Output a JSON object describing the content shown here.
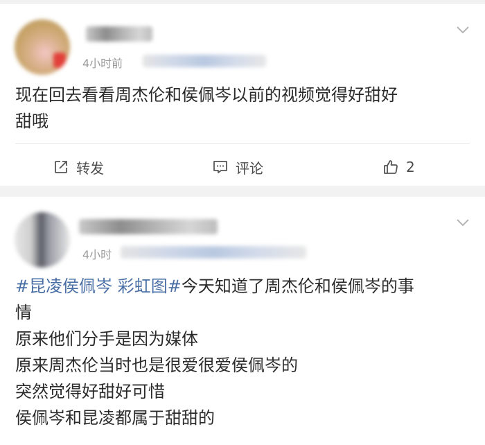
{
  "posts": [
    {
      "time": "4小时前",
      "content_lines": [
        "现在回去看看周杰伦和侯佩岑以前的视频觉得好甜好",
        "甜哦"
      ],
      "actions": {
        "repost_label": "转发",
        "comment_label": "评论",
        "like_count": "2"
      }
    },
    {
      "time": "4小时",
      "hashtag_1": "#昆凌侯佩岑",
      "hashtag_2": "彩虹图#",
      "first_line_rest": "今天知道了周杰伦和侯佩岑的事",
      "content_lines": [
        "情",
        "原来他们分手是因为媒体",
        "原来周杰伦当时也是很爱很爱侯佩岑的",
        "突然觉得好甜好可惜",
        "侯佩岑和昆凌都属于甜甜的"
      ]
    }
  ],
  "colors": {
    "hashtag": "#4a6fa5",
    "background": "#f2f2f2",
    "card": "#ffffff"
  },
  "icons": {
    "more": "chevron-down-icon",
    "repost": "share-square-icon",
    "comment": "comment-bubble-icon",
    "like": "thumbs-up-icon"
  }
}
